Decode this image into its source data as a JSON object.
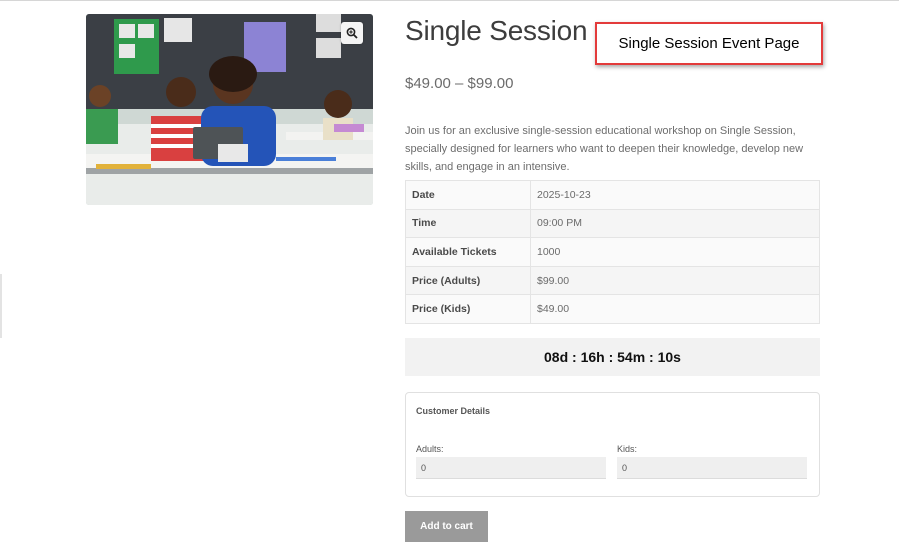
{
  "product": {
    "title": "Single Session",
    "price_range": "$49.00 – $99.00",
    "description": "Join us for an exclusive single-session educational workshop on Single Session, specially designed for learners who want to deepen their knowledge, develop new skills, and engage in an intensive."
  },
  "annotation": {
    "text": "Single Session Event Page"
  },
  "details": [
    {
      "label": "Date",
      "value": "2025-10-23"
    },
    {
      "label": "Time",
      "value": "09:00 PM"
    },
    {
      "label": "Available Tickets",
      "value": "1000"
    },
    {
      "label": "Price (Adults)",
      "value": "$99.00"
    },
    {
      "label": "Price (Kids)",
      "value": "$49.00"
    }
  ],
  "countdown": {
    "text": "08d : 16h : 54m : 10s"
  },
  "customer_details": {
    "title": "Customer Details",
    "adults_label": "Adults:",
    "adults_value": "0",
    "kids_label": "Kids:",
    "kids_value": "0"
  },
  "cart": {
    "button_label": "Add to cart"
  },
  "icons": {
    "zoom": "zoom-in-magnifier-icon"
  }
}
